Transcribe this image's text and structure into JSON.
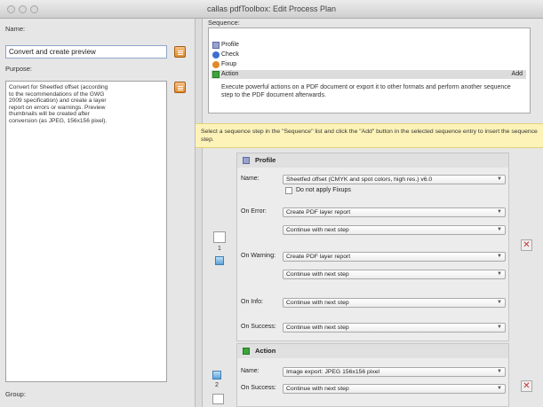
{
  "window": {
    "title": "callas pdfToolbox: Edit Process Plan"
  },
  "left": {
    "name_label": "Name:",
    "name_value": "Convert and create preview",
    "purpose_label": "Purpose:",
    "purpose_text": "Convert for Sheetfed offset (according\nto the recommendations of the GWG\n2009 specification) and create a layer\nreport on errors or warnings. Preview\nthumbnails will be created after\nconversion (as JPEG, 156x156 pixel).",
    "group_label": "Group:"
  },
  "sequence": {
    "label": "Sequence:",
    "items": [
      {
        "label": "Profile",
        "icon": "profile-icon"
      },
      {
        "label": "Check",
        "icon": "check-icon"
      },
      {
        "label": "Fixup",
        "icon": "fixup-icon"
      },
      {
        "label": "Action",
        "icon": "action-icon"
      }
    ],
    "add_label": "Add",
    "description": "Execute powerful actions on a PDF document or export it to other formats and perform another sequence step to the PDF document afterwards."
  },
  "hint": "Select a sequence step in the \"Sequence\" list and click the \"Add\" button in the selected sequence entry to insert the sequence step.",
  "profile_panel": {
    "title": "Profile",
    "name_label": "Name:",
    "name_value": "Sheetfed offset (CMYK and spot colors, high res.) v6.0",
    "no_fixups_label": "Do not apply Fixups",
    "on_error_label": "On Error:",
    "on_error_value": "Create PDF layer report",
    "on_error_next": "Continue with next step",
    "on_warning_label": "On Warning:",
    "on_warning_value": "Create PDF layer report",
    "on_warning_next": "Continue with next step",
    "on_info_label": "On Info:",
    "on_info_value": "Continue with next step",
    "on_success_label": "On Success:",
    "on_success_value": "Continue with next step"
  },
  "action_panel": {
    "title": "Action",
    "name_label": "Name:",
    "name_value": "Image export: JPEG 156x156 pixel",
    "on_success_label": "On Success:",
    "on_success_value": "Continue with next step"
  },
  "side": {
    "step1": "1",
    "step2": "2"
  }
}
